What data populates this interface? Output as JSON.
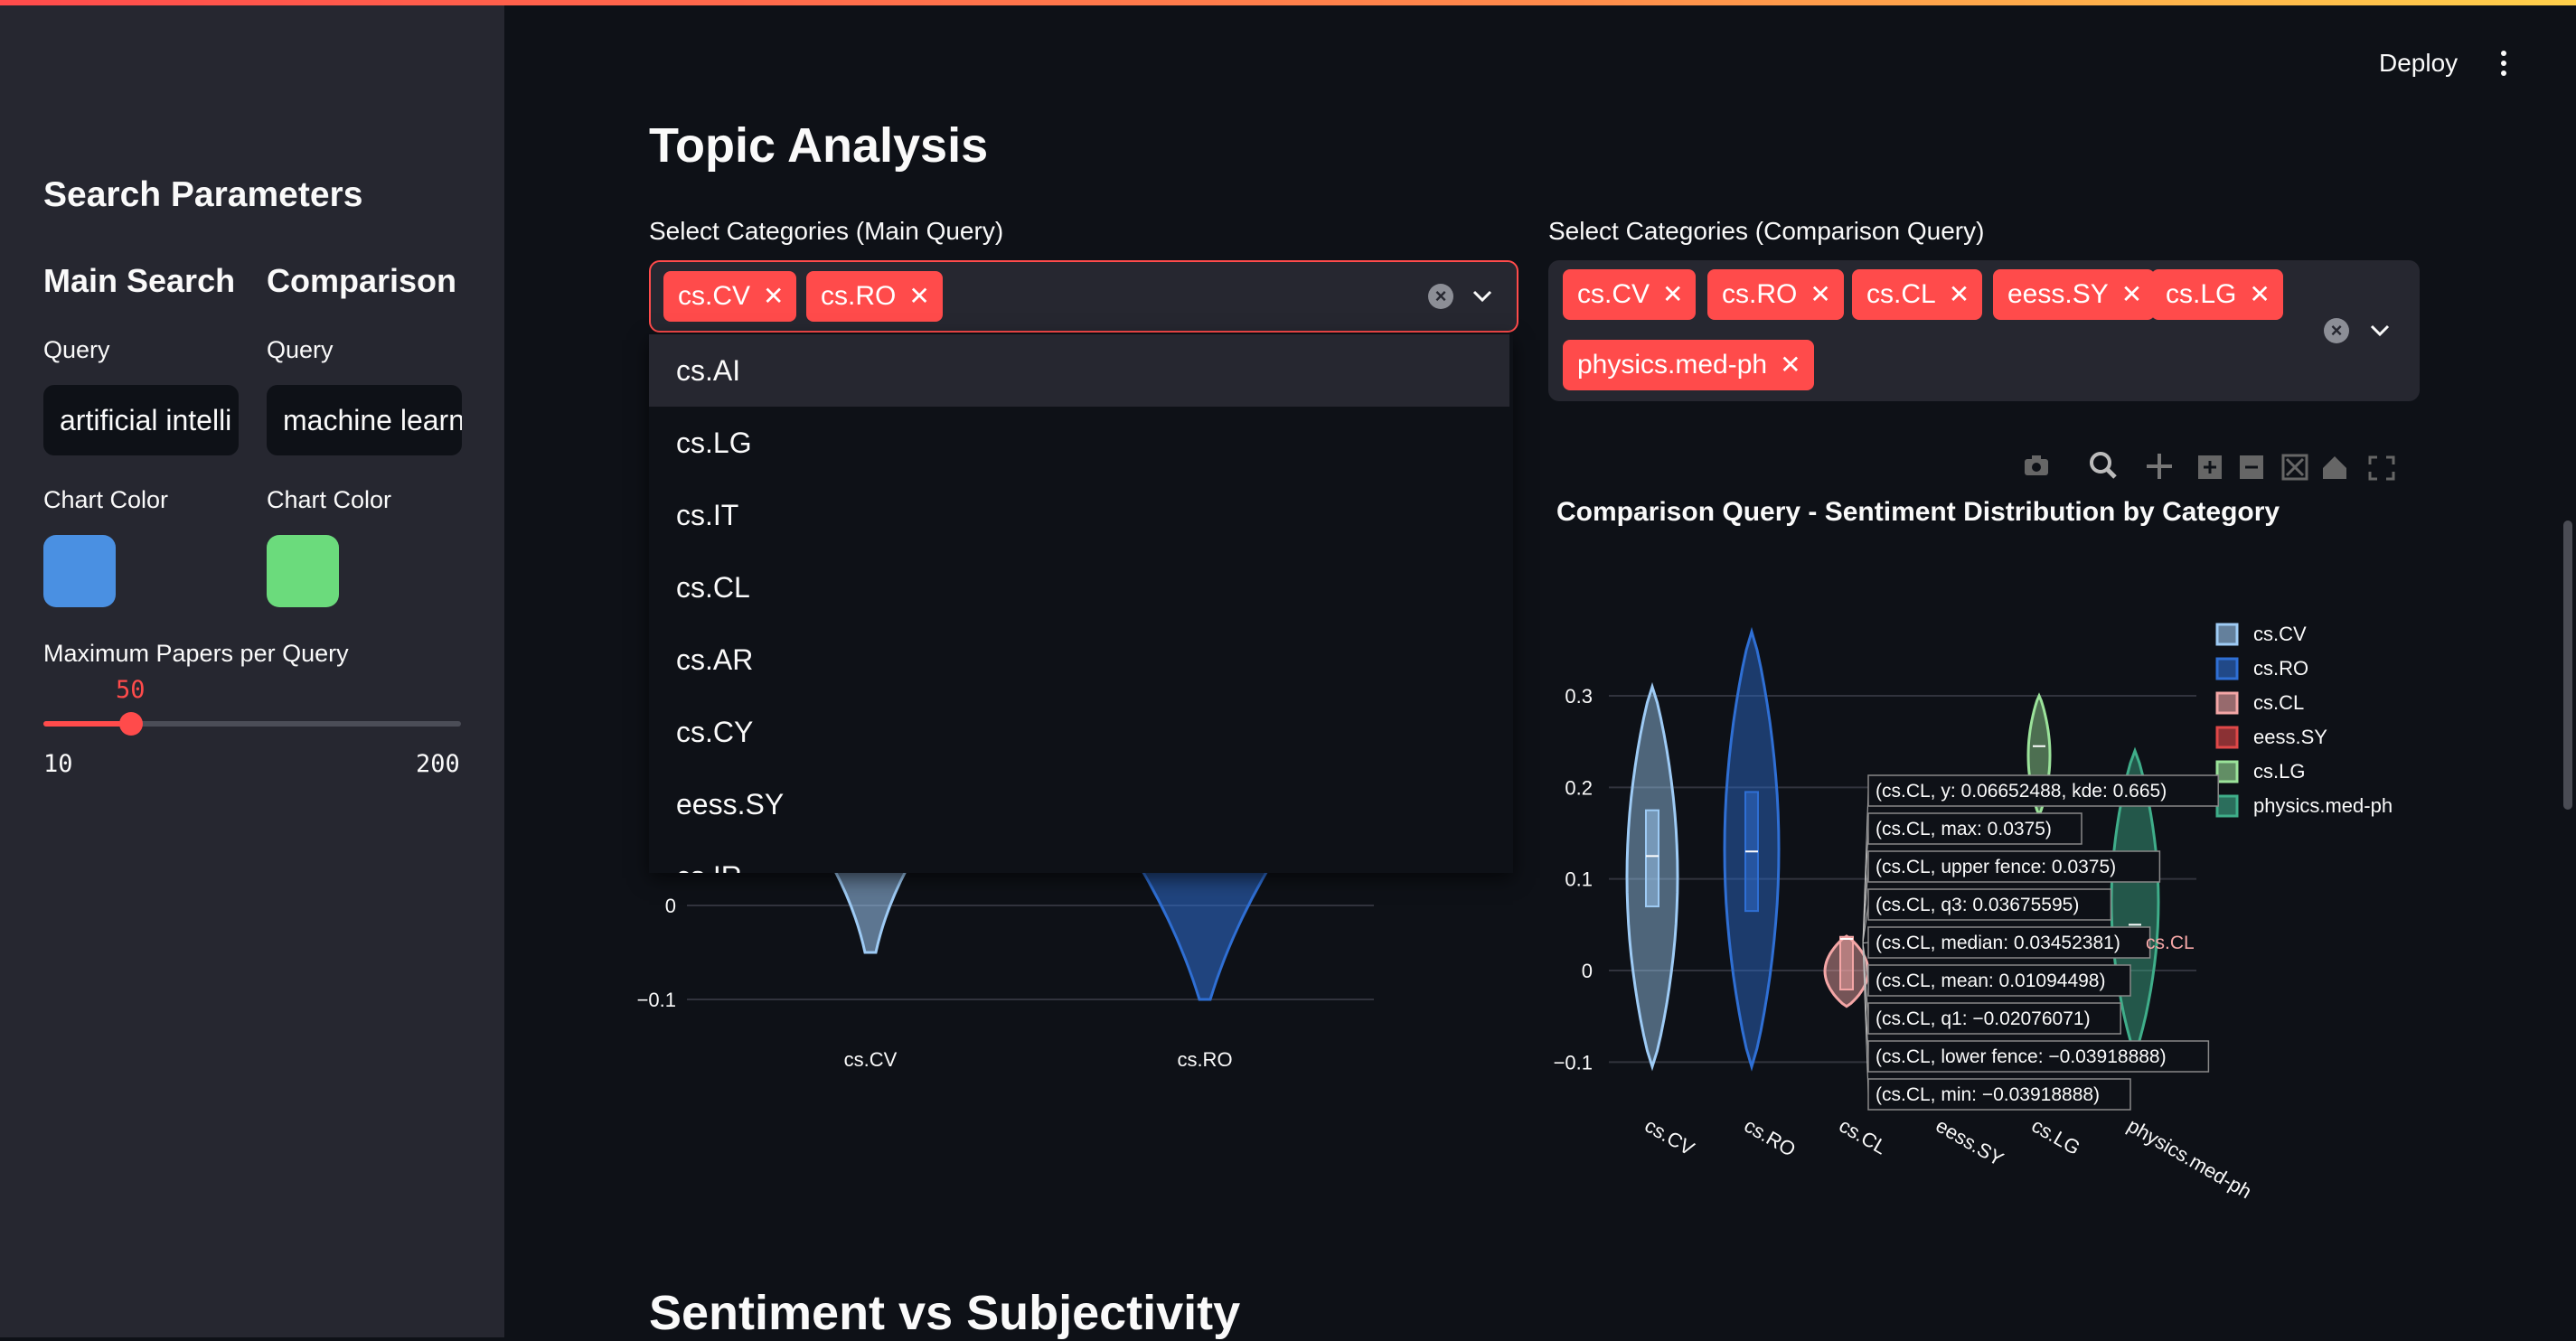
{
  "sidebar": {
    "title": "Search Parameters",
    "main": {
      "heading": "Main Search",
      "query_label": "Query",
      "query_value": "artificial intelli",
      "color_label": "Chart Color",
      "color": "#4a90e2"
    },
    "comparison": {
      "heading": "Comparison",
      "query_label": "Query",
      "query_value": "machine learn",
      "color_label": "Chart Color",
      "color": "#6bdb7c"
    },
    "slider": {
      "label": "Maximum Papers per Query",
      "value": "50",
      "min": "10",
      "max": "200",
      "fraction": 0.21
    }
  },
  "header": {
    "deploy_label": "Deploy"
  },
  "main": {
    "title": "Topic Analysis",
    "next_section_title": "Sentiment vs Subjectivity",
    "main_select": {
      "label": "Select Categories (Main Query)",
      "tags": [
        "cs.CV",
        "cs.RO"
      ]
    },
    "comparison_select": {
      "label": "Select Categories (Comparison Query)",
      "tags": [
        "cs.CV",
        "cs.RO",
        "cs.CL",
        "eess.SY",
        "cs.LG",
        "physics.med-ph"
      ]
    },
    "dropdown_options": [
      "cs.AI",
      "cs.LG",
      "cs.IT",
      "cs.CL",
      "cs.AR",
      "cs.CY",
      "eess.SY",
      "cs.IR"
    ]
  },
  "chart_data": [
    {
      "type": "violin",
      "title": "",
      "categories": [
        "cs.CV",
        "cs.RO"
      ],
      "y_ticks": [
        "0",
        "−0.1"
      ],
      "visible_note": "upper portion hidden behind dropdown",
      "series": [
        {
          "name": "cs.CV",
          "color": "#9ecbf5",
          "min": -0.05
        },
        {
          "name": "cs.RO",
          "color": "#2f6fd4",
          "min": -0.1
        }
      ]
    },
    {
      "type": "violin",
      "title": "Comparison Query - Sentiment Distribution by Category",
      "categories": [
        "cs.CV",
        "cs.RO",
        "cs.CL",
        "eess.SY",
        "cs.LG",
        "physics.med-ph"
      ],
      "y_ticks": [
        "0.3",
        "0.2",
        "0.1",
        "0",
        "−0.1"
      ],
      "ylim": [
        -0.13,
        0.38
      ],
      "series": [
        {
          "name": "cs.CV",
          "color": "#9ecbf5",
          "min": -0.105,
          "q1": 0.07,
          "median": 0.125,
          "q3": 0.175,
          "max": 0.31
        },
        {
          "name": "cs.RO",
          "color": "#2f6fd4",
          "min": -0.105,
          "q1": 0.065,
          "median": 0.13,
          "q3": 0.195,
          "max": 0.37
        },
        {
          "name": "cs.CL",
          "color": "#f4a6a6",
          "min": -0.03918888,
          "q1": -0.02076071,
          "median": 0.03452381,
          "q3": 0.03675595,
          "max": 0.0375,
          "mean": 0.01094498
        },
        {
          "name": "eess.SY",
          "color": "#e04848"
        },
        {
          "name": "cs.LG",
          "color": "#9be39a",
          "min": 0.17,
          "median": 0.245,
          "max": 0.3
        },
        {
          "name": "physics.med-ph",
          "color": "#3fae8a",
          "min": -0.09,
          "median": 0.05,
          "max": 0.24
        }
      ],
      "legend": {
        "position": "right",
        "entries": [
          "cs.CV",
          "cs.RO",
          "cs.CL",
          "eess.SY",
          "cs.LG",
          "physics.med-ph"
        ]
      },
      "hover_tooltips": [
        "(cs.CL, y: 0.06652488, kde: 0.665)",
        "(cs.CL, max: 0.0375)",
        "(cs.CL, upper fence: 0.0375)",
        "(cs.CL, q3: 0.03675595)",
        "(cs.CL, median: 0.03452381)",
        "(cs.CL, mean: 0.01094498)",
        "(cs.CL, q1: −0.02076071)",
        "(cs.CL, lower fence: −0.03918888)",
        "(cs.CL, min: −0.03918888)"
      ],
      "hover_category_label": "cs.CL"
    }
  ]
}
